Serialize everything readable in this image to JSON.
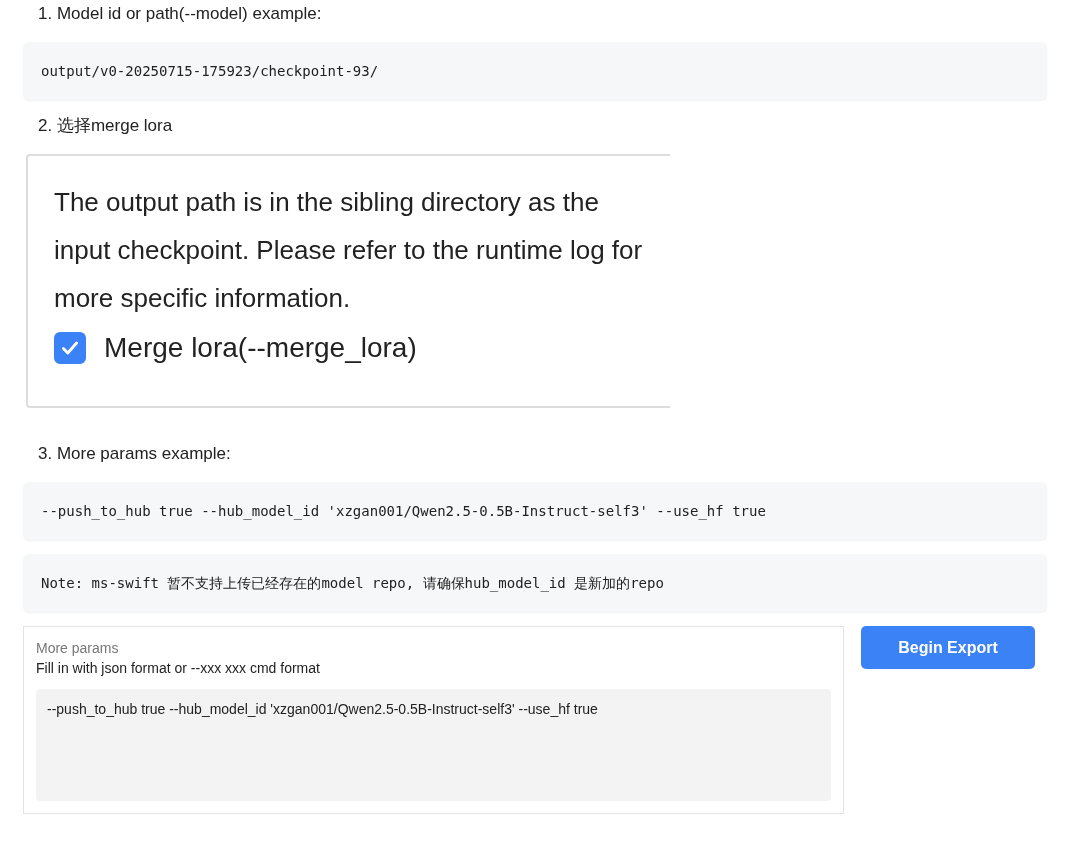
{
  "blocks": [
    {
      "kind": "heading",
      "text": "1. Model id or path(--model) example:"
    },
    {
      "kind": "code",
      "text": "output/v0-20250715-175923/checkpoint-93/"
    },
    {
      "kind": "heading",
      "text": "2. 选择merge lora"
    },
    {
      "kind": "panel",
      "description": "The output path is in the sibling directory as the input checkpoint. Please refer to the runtime log for more specific information.",
      "checkbox": {
        "label": "Merge lora(--merge_lora)",
        "checked": true
      }
    },
    {
      "kind": "heading",
      "text": "3. More params example:"
    },
    {
      "kind": "code",
      "text": "--push_to_hub true --hub_model_id 'xzgan001/Qwen2.5-0.5B-Instruct-self3' --use_hf true"
    },
    {
      "kind": "code",
      "text": "Note: ms-swift 暂不支持上传已经存在的model repo, 请确保hub_model_id 是新加的repo"
    },
    {
      "kind": "form",
      "label": "More params",
      "hint": "Fill in with json format or --xxx xxx cmd format",
      "value": "--push_to_hub true --hub_model_id 'xzgan001/Qwen2.5-0.5B-Instruct-self3' --use_hf true",
      "button": "Begin Export"
    }
  ]
}
